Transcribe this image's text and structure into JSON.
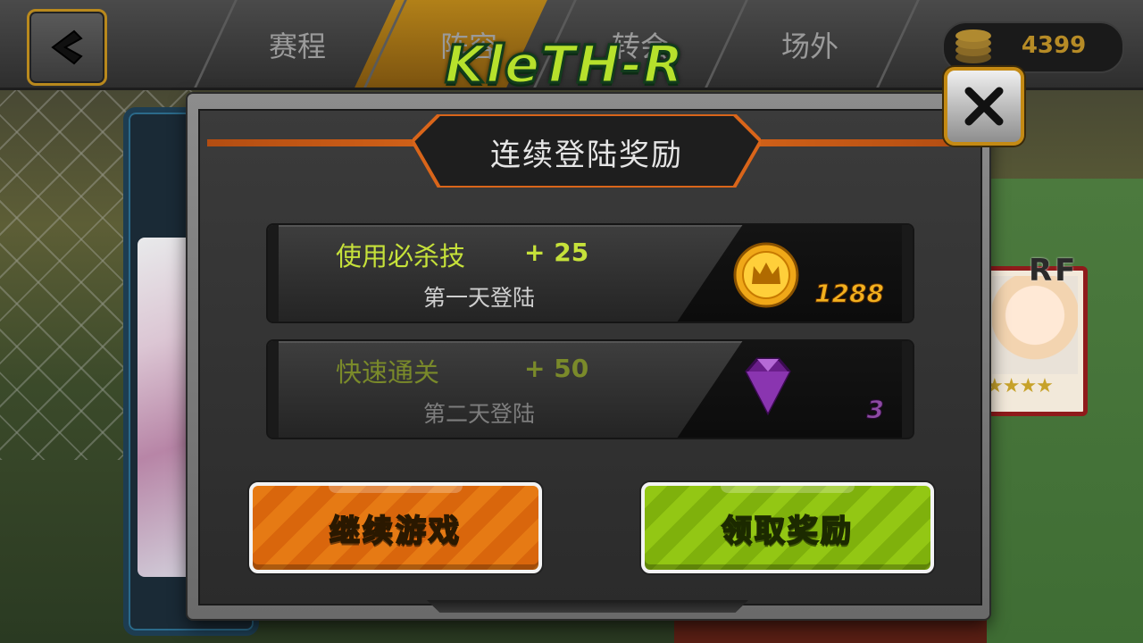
{
  "topbar": {
    "tabs": [
      "赛程",
      "阵容",
      "转会",
      "场外"
    ],
    "coin_count": "4399"
  },
  "logo": "KleTH-R",
  "background": {
    "card_position_label": "RF",
    "card_stars": "★★★★"
  },
  "dialog": {
    "title": "连续登陆奖励",
    "rewards": [
      {
        "skill": "使用必杀技",
        "bonus": "+ 25",
        "day": "第一天登陆",
        "item_icon": "gold-crown-coin-icon",
        "amount": "1288"
      },
      {
        "skill": "快速通关",
        "bonus": "+ 50",
        "day": "第二天登陆",
        "item_icon": "purple-gem-icon",
        "amount": "3"
      }
    ],
    "continue_label": "继续游戏",
    "claim_label": "领取奖励"
  },
  "colors": {
    "accent_orange": "#e7701d",
    "accent_green": "#93c714",
    "skill_text": "#c6e13a",
    "coin_gold": "#f2b01e",
    "gem_purple": "#8d4aa3"
  }
}
